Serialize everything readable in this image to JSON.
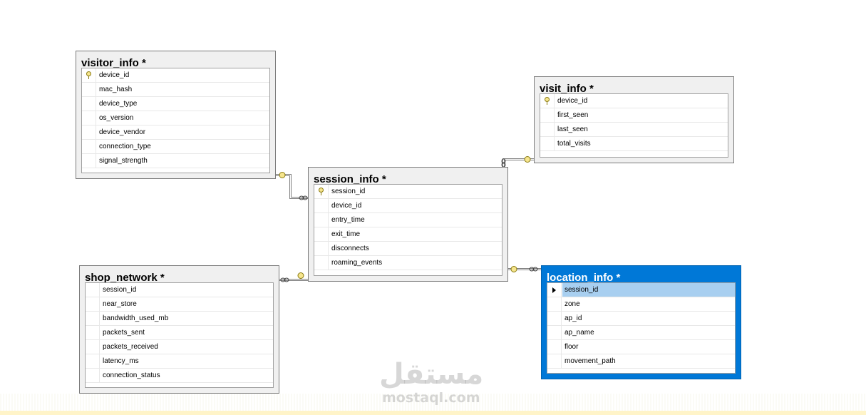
{
  "tables": [
    {
      "id": "visitor_info",
      "title": "visitor_info *",
      "selected": false,
      "columns": [
        {
          "name": "device_id",
          "key": true
        },
        {
          "name": "mac_hash"
        },
        {
          "name": "device_type"
        },
        {
          "name": "os_version"
        },
        {
          "name": "device_vendor"
        },
        {
          "name": "connection_type"
        },
        {
          "name": "signal_strength"
        }
      ]
    },
    {
      "id": "visit_info",
      "title": "visit_info *",
      "selected": false,
      "columns": [
        {
          "name": "device_id",
          "key": true
        },
        {
          "name": "first_seen"
        },
        {
          "name": "last_seen"
        },
        {
          "name": "total_visits"
        }
      ]
    },
    {
      "id": "session_info",
      "title": "session_info *",
      "selected": false,
      "columns": [
        {
          "name": "session_id",
          "key": true
        },
        {
          "name": "device_id"
        },
        {
          "name": "entry_time"
        },
        {
          "name": "exit_time"
        },
        {
          "name": "disconnects"
        },
        {
          "name": "roaming_events"
        }
      ]
    },
    {
      "id": "shop_network",
      "title": "shop_network *",
      "selected": false,
      "columns": [
        {
          "name": "session_id"
        },
        {
          "name": "near_store"
        },
        {
          "name": "bandwidth_used_mb"
        },
        {
          "name": "packets_sent"
        },
        {
          "name": "packets_received"
        },
        {
          "name": "latency_ms"
        },
        {
          "name": "connection_status"
        }
      ]
    },
    {
      "id": "location_info",
      "title": "location_info *",
      "selected": true,
      "columns": [
        {
          "name": "session_id",
          "active": true
        },
        {
          "name": "zone"
        },
        {
          "name": "ap_id"
        },
        {
          "name": "ap_name"
        },
        {
          "name": "floor"
        },
        {
          "name": "movement_path"
        }
      ]
    }
  ],
  "relationships": [
    {
      "from": "visitor_info",
      "to": "session_info",
      "one_end": "visitor_info",
      "many_end": "session_info"
    },
    {
      "from": "visit_info",
      "to": "session_info",
      "one_end": "visit_info",
      "many_end": "session_info"
    },
    {
      "from": "shop_network",
      "to": "session_info",
      "one_end": "session_info",
      "many_end": "shop_network"
    },
    {
      "from": "session_info",
      "to": "location_info",
      "one_end": "session_info",
      "many_end": "location_info"
    }
  ],
  "icons": {
    "primary_key": "key-icon",
    "current_row": "row-pointer-icon",
    "one_end": "key-endpoint-icon",
    "many_end": "infinity-endpoint-icon"
  },
  "colors": {
    "selected_table": "#0078d7",
    "active_row": "#a8cff0",
    "key": "#f6e58d"
  },
  "watermark": {
    "arabic": "مستقل",
    "url": "mostaql.com"
  }
}
